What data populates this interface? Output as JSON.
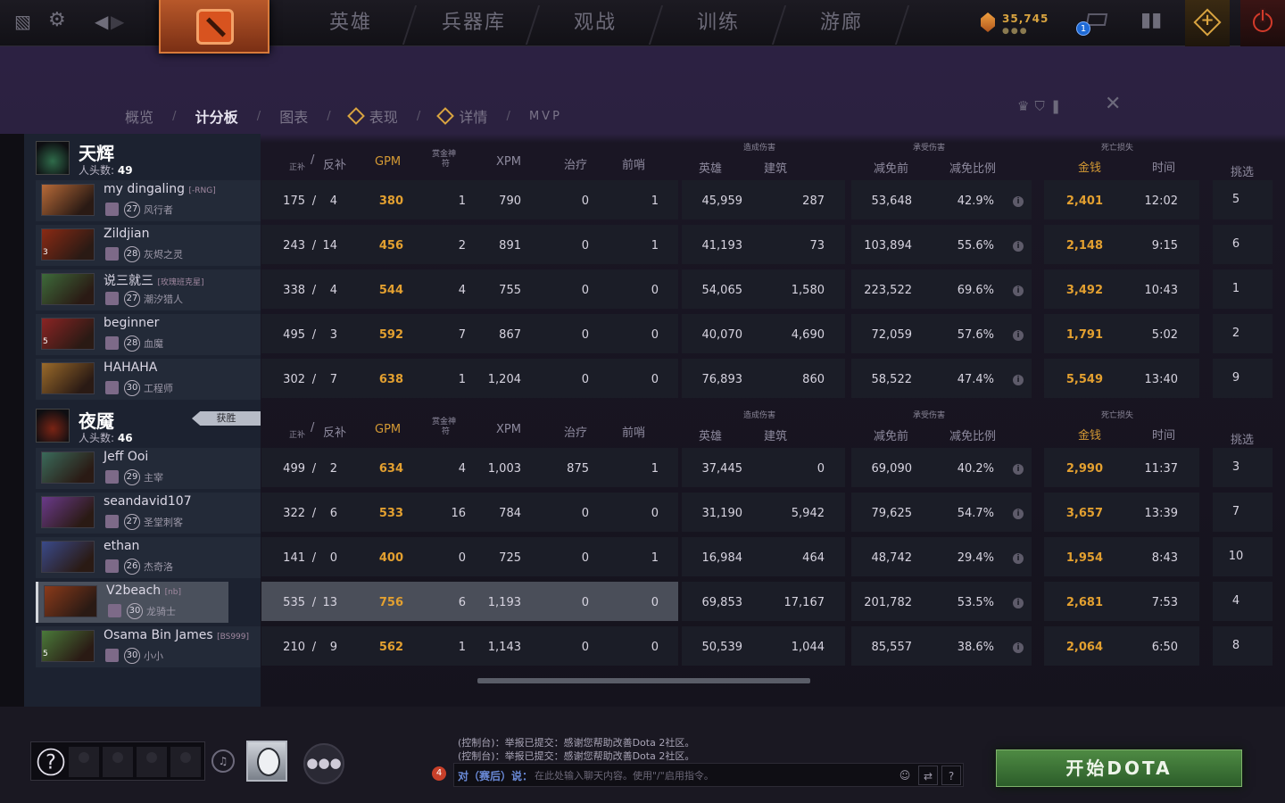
{
  "topnav": {
    "tabs": [
      "英雄",
      "兵器库",
      "观战",
      "训练",
      "游廊"
    ],
    "gold": "35,745",
    "gold_dots": "●●●",
    "mail_count": "1"
  },
  "subnav": {
    "items": [
      "概览",
      "计分板",
      "图表",
      "表现",
      "详情",
      "MVP"
    ],
    "separator": "/"
  },
  "headers": {
    "kd_a": "正补",
    "kd_sep": "/",
    "kd_b": "反补",
    "gpm": "GPM",
    "bounty_a": "赏金神",
    "bounty_b": "符",
    "xpm": "XPM",
    "heal": "治疗",
    "wards": "前哨",
    "dmg_group": "造成伤害",
    "dmg_hero": "英雄",
    "dmg_building": "建筑",
    "taken_group": "承受伤害",
    "taken_before": "减免前",
    "taken_ratio": "减免比例",
    "death_group": "死亡损失",
    "death_gold": "金钱",
    "death_time": "时间",
    "pick": "挑选"
  },
  "teams": [
    {
      "name": "天辉",
      "kills_label": "人头数:",
      "kills": "49",
      "emblem_color": "#2f6b4a",
      "players": [
        {
          "name": "my dingaling",
          "tag": "[-RNG]",
          "level": "27",
          "hero": "风行者",
          "streak": "",
          "portrait": "#b76a38",
          "lh": "175",
          "dn": "4",
          "gpm": "380",
          "bounty": "1",
          "xpm": "790",
          "heal": "0",
          "wards": "1",
          "dmg_hero": "45,959",
          "dmg_building": "287",
          "taken": "53,648",
          "ratio": "42.9%",
          "death_gold": "2,401",
          "death_time": "12:02",
          "pick": "5"
        },
        {
          "name": "Zildjian",
          "tag": "",
          "level": "28",
          "hero": "灰烬之灵",
          "streak": "3",
          "portrait": "#8a2a14",
          "lh": "243",
          "dn": "14",
          "gpm": "456",
          "bounty": "2",
          "xpm": "891",
          "heal": "0",
          "wards": "1",
          "dmg_hero": "41,193",
          "dmg_building": "73",
          "taken": "103,894",
          "ratio": "55.6%",
          "death_gold": "2,148",
          "death_time": "9:15",
          "pick": "6"
        },
        {
          "name": "说三就三",
          "tag": "[玫瑰班克星]",
          "level": "27",
          "hero": "潮汐猎人",
          "streak": "",
          "portrait": "#3d6a3a",
          "lh": "338",
          "dn": "4",
          "gpm": "544",
          "bounty": "4",
          "xpm": "755",
          "heal": "0",
          "wards": "0",
          "dmg_hero": "54,065",
          "dmg_building": "1,580",
          "taken": "223,522",
          "ratio": "69.6%",
          "death_gold": "3,492",
          "death_time": "10:43",
          "pick": "1"
        },
        {
          "name": "beginner",
          "tag": "",
          "level": "28",
          "hero": "血魔",
          "streak": "5",
          "portrait": "#8a2424",
          "lh": "495",
          "dn": "3",
          "gpm": "592",
          "bounty": "7",
          "xpm": "867",
          "heal": "0",
          "wards": "0",
          "dmg_hero": "40,070",
          "dmg_building": "4,690",
          "taken": "72,059",
          "ratio": "57.6%",
          "death_gold": "1,791",
          "death_time": "5:02",
          "pick": "2"
        },
        {
          "name": "HAHAHA",
          "tag": "",
          "level": "30",
          "hero": "工程师",
          "streak": "",
          "portrait": "#9a6a2a",
          "lh": "302",
          "dn": "7",
          "gpm": "638",
          "bounty": "1",
          "xpm": "1,204",
          "heal": "0",
          "wards": "0",
          "dmg_hero": "76,893",
          "dmg_building": "860",
          "taken": "58,522",
          "ratio": "47.4%",
          "death_gold": "5,549",
          "death_time": "13:40",
          "pick": "9"
        }
      ]
    },
    {
      "name": "夜魇",
      "kills_label": "人头数:",
      "kills": "46",
      "emblem_color": "#7a2414",
      "win_label": "获胜",
      "players": [
        {
          "name": "Jeff Ooi",
          "tag": "",
          "level": "29",
          "hero": "主宰",
          "streak": "",
          "portrait": "#3a6a5a",
          "lh": "499",
          "dn": "2",
          "gpm": "634",
          "bounty": "4",
          "xpm": "1,003",
          "heal": "875",
          "wards": "1",
          "dmg_hero": "37,445",
          "dmg_building": "0",
          "taken": "69,090",
          "ratio": "40.2%",
          "death_gold": "2,990",
          "death_time": "11:37",
          "pick": "3"
        },
        {
          "name": "seandavid107",
          "tag": "",
          "level": "27",
          "hero": "圣堂刺客",
          "streak": "",
          "portrait": "#6a3a8a",
          "lh": "322",
          "dn": "6",
          "gpm": "533",
          "bounty": "16",
          "xpm": "784",
          "heal": "0",
          "wards": "0",
          "dmg_hero": "31,190",
          "dmg_building": "5,942",
          "taken": "79,625",
          "ratio": "54.7%",
          "death_gold": "3,657",
          "death_time": "13:39",
          "pick": "7"
        },
        {
          "name": "ethan",
          "tag": "",
          "level": "26",
          "hero": "杰奇洛",
          "streak": "",
          "portrait": "#3a4a8a",
          "lh": "141",
          "dn": "0",
          "gpm": "400",
          "bounty": "0",
          "xpm": "725",
          "heal": "0",
          "wards": "1",
          "dmg_hero": "16,984",
          "dmg_building": "464",
          "taken": "48,742",
          "ratio": "29.4%",
          "death_gold": "1,954",
          "death_time": "8:43",
          "pick": "10"
        },
        {
          "name": "V2beach",
          "tag": "[nb]",
          "level": "30",
          "hero": "龙骑士",
          "streak": "",
          "portrait": "#8a3a1a",
          "lh": "535",
          "dn": "13",
          "gpm": "756",
          "bounty": "6",
          "xpm": "1,193",
          "heal": "0",
          "wards": "0",
          "dmg_hero": "69,853",
          "dmg_building": "17,167",
          "taken": "201,782",
          "ratio": "53.5%",
          "death_gold": "2,681",
          "death_time": "7:53",
          "pick": "4",
          "selected": true
        },
        {
          "name": "Osama Bin James",
          "tag": "[BS999]",
          "level": "30",
          "hero": "小小",
          "streak": "5",
          "portrait": "#4a7a3a",
          "lh": "210",
          "dn": "9",
          "gpm": "562",
          "bounty": "1",
          "xpm": "1,143",
          "heal": "0",
          "wards": "0",
          "dmg_hero": "50,539",
          "dmg_building": "1,044",
          "taken": "85,557",
          "ratio": "38.6%",
          "death_gold": "2,064",
          "death_time": "6:50",
          "pick": "8"
        }
      ]
    }
  ],
  "chat": {
    "lines": [
      "(控制台)：举报已提交：感谢您帮助改善Dota 2社区。",
      "(控制台)：举报已提交：感谢您帮助改善Dota 2社区。"
    ],
    "badge": "4",
    "prefix": "对（赛后）说：",
    "placeholder": "在此处输入聊天内容。使用\"/\"启用指令。",
    "help": "?"
  },
  "play_button": "开始DOTA",
  "colors": {
    "accent_gold": "#e3a030",
    "play_green": "#4e8a43"
  }
}
